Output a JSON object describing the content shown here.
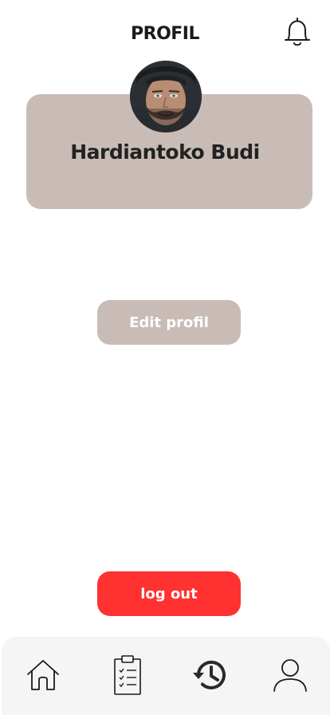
{
  "header": {
    "title": "PROFIL",
    "notification_icon": "bell-icon"
  },
  "profile": {
    "name": "Hardiantoko Budi",
    "card_color": "#c9bcb6"
  },
  "actions": {
    "edit_label": "Edit profil",
    "logout_label": "log out",
    "logout_color": "#ff3131"
  },
  "bottom_nav": {
    "items": [
      {
        "icon": "home-icon"
      },
      {
        "icon": "clipboard-checklist-icon"
      },
      {
        "icon": "history-icon"
      },
      {
        "icon": "user-icon"
      }
    ]
  }
}
